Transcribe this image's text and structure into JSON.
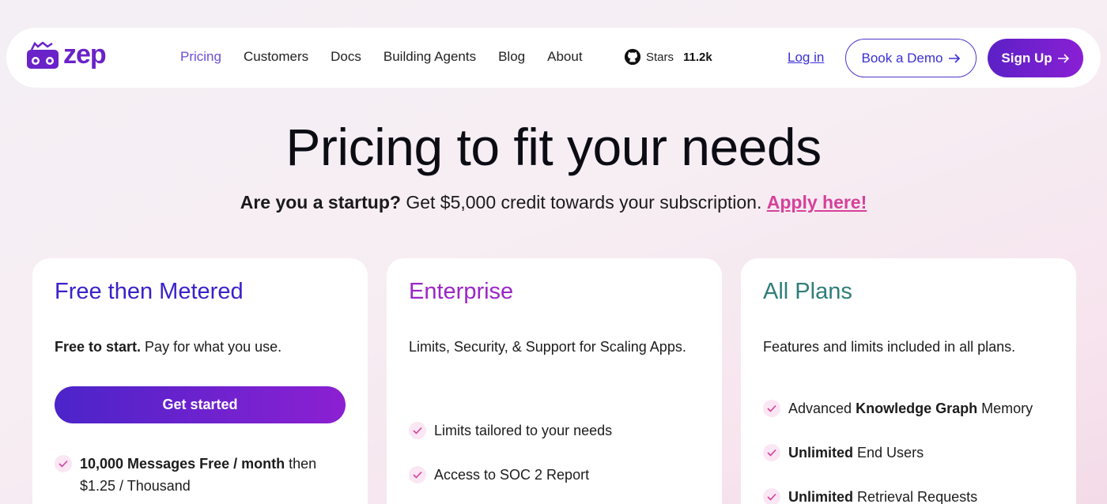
{
  "nav": {
    "logo_text": "zep",
    "links": [
      "Pricing",
      "Customers",
      "Docs",
      "Building Agents",
      "Blog",
      "About"
    ],
    "active_link": "Pricing",
    "stars_label": "Stars",
    "stars_count": "11.2k",
    "login": "Log in",
    "demo": "Book a Demo",
    "signup": "Sign Up"
  },
  "hero": {
    "title": "Pricing to fit your needs",
    "startup_q": "Are you a startup?",
    "startup_text": "Get $5,000 credit towards your subscription.",
    "apply": "Apply here!"
  },
  "plans": {
    "free": {
      "title": "Free then Metered",
      "desc_bold": "Free to start.",
      "desc": "Pay for what you use.",
      "cta": "Get started",
      "feature1_bold": "10,000 Messages Free / month",
      "feature1_rest": "then $1.25 / Thousand"
    },
    "enterprise": {
      "title": "Enterprise",
      "desc": "Limits, Security, & Support for Scaling Apps.",
      "feature1": "Limits tailored to your needs",
      "feature2": "Access to SOC 2 Report"
    },
    "all": {
      "title": "All Plans",
      "desc": "Features and limits included in all plans.",
      "feature1_pre": "Advanced",
      "feature1_bold": "Knowledge Graph",
      "feature1_post": "Memory",
      "feature2_bold": "Unlimited",
      "feature2_rest": "End Users",
      "feature3_bold": "Unlimited",
      "feature3_rest": "Retrieval Requests"
    }
  },
  "colors": {
    "brand": "#6a22c9",
    "accent_link": "#d6409a",
    "free_title": "#3a21c9",
    "enterprise_title": "#9b26c7",
    "all_title": "#2f7e79"
  }
}
